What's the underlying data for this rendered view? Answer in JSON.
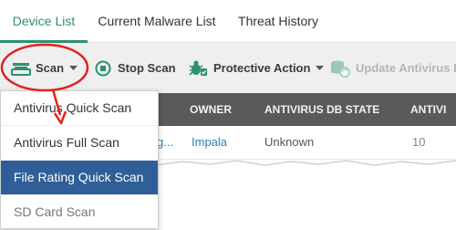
{
  "tabs": [
    {
      "label": "Device List",
      "active": true
    },
    {
      "label": "Current Malware List",
      "active": false
    },
    {
      "label": "Threat History",
      "active": false
    }
  ],
  "toolbar": {
    "scan_label": "Scan",
    "stop_scan_label": "Stop Scan",
    "protective_action_label": "Protective Action",
    "update_antivirus_label": "Update Antivirus DB"
  },
  "table": {
    "columns": [
      "OWNER",
      "ANTIVIRUS DB STATE",
      "ANTIVI"
    ],
    "row": {
      "device": "g...",
      "owner": "Impala",
      "db_state": "Unknown",
      "version": "10"
    }
  },
  "scan_menu": [
    {
      "label": "Antivirus Quick Scan",
      "state": "normal"
    },
    {
      "label": "Antivirus Full Scan",
      "state": "normal"
    },
    {
      "label": "File Rating Quick Scan",
      "state": "selected"
    },
    {
      "label": "SD Card Scan",
      "state": "disabled"
    }
  ],
  "colors": {
    "accent": "#2e8f73",
    "header_bg": "#5a5a5a",
    "toolbar_bg": "#efefef",
    "menu_selected": "#2f5f96",
    "annotation": "#e0221b",
    "link": "#2a7fb8"
  },
  "icons": [
    "scanner-icon",
    "stop-circle-icon",
    "protective-action-icon",
    "database-refresh-icon",
    "caret-down-icon"
  ]
}
